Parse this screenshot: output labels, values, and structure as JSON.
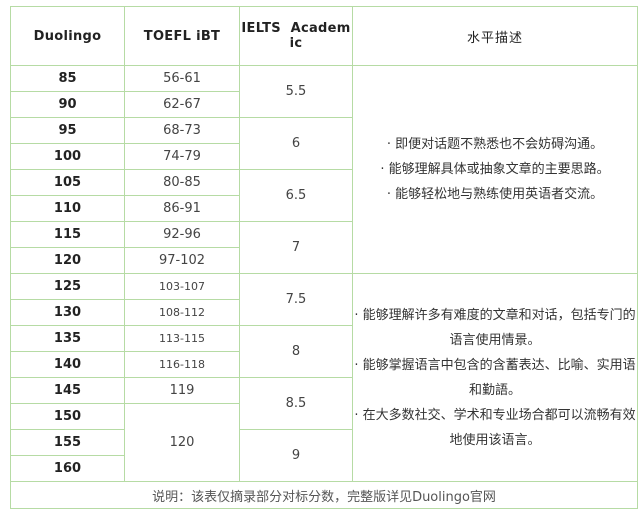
{
  "headers": {
    "duolingo": "Duolingo",
    "toefl": "TOEFL iBT",
    "ielts_line1": "IELTS  Academ",
    "ielts_line2": "ic",
    "desc": "水平描述"
  },
  "rows": [
    {
      "duo": "85",
      "toefl": "56-61"
    },
    {
      "duo": "90",
      "toefl": "62-67"
    },
    {
      "duo": "95",
      "toefl": "68-73"
    },
    {
      "duo": "100",
      "toefl": "74-79"
    },
    {
      "duo": "105",
      "toefl": "80-85"
    },
    {
      "duo": "110",
      "toefl": "86-91"
    },
    {
      "duo": "115",
      "toefl": "92-96"
    },
    {
      "duo": "120",
      "toefl": "97-102"
    },
    {
      "duo": "125",
      "toefl": "103-107"
    },
    {
      "duo": "130",
      "toefl": "108-112"
    },
    {
      "duo": "135",
      "toefl": "113-115"
    },
    {
      "duo": "140",
      "toefl": "116-118"
    },
    {
      "duo": "145",
      "toefl": "119"
    },
    {
      "duo": "150"
    },
    {
      "duo": "155",
      "toefl": "120"
    },
    {
      "duo": "160"
    }
  ],
  "ielts": [
    "5.5",
    "6",
    "6.5",
    "7",
    "7.5",
    "8",
    "8.5",
    "9"
  ],
  "desc_block1": [
    "· 即便对话题不熟悉也不会妨碍沟通。",
    "· 能够理解具体或抽象文章的主要思路。",
    "· 能够轻松地与熟练使用英语者交流。"
  ],
  "desc_block2": [
    "· 能够理解许多有难度的文章和对话，包括专门的语言使用情景。",
    "· 能够掌握语言中包含的含蓄表达、比喻、实用语和勤語。",
    "· 在大多数社交、学术和专业场合都可以流畅有效地使用该语言。"
  ],
  "note": "说明：该表仅摘录部分对标分数，完整版详见Duolingo官网"
}
